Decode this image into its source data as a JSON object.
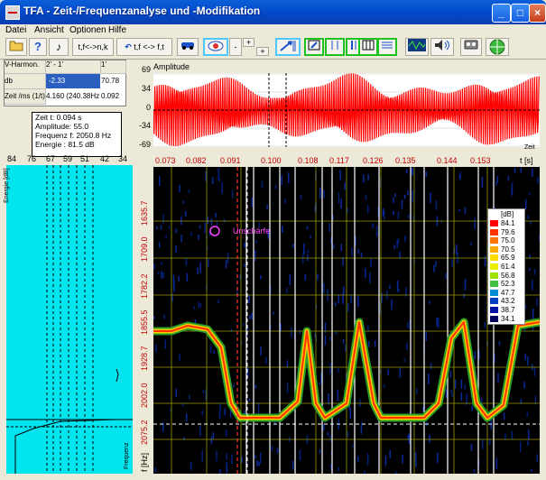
{
  "window": {
    "title": "TFA - Zeit-/Frequenzanalyse und -Modifikation"
  },
  "menu": [
    "Datei",
    "Ansicht",
    "Optionen",
    "Hilfe"
  ],
  "toolbar": {
    "btn_tfnk": "t,f<->n,k",
    "btn_tftf": "t,f <-> f,t",
    "zoom_minus": "-",
    "zoom_plus": "+",
    "zoom_plus2": "+"
  },
  "infogrid": {
    "h1": "V-Harmon.",
    "h2": "2' - 1'",
    "h3": "1'",
    "r1c1": "db",
    "r1c2": "-2.33",
    "r1c3": "70.78",
    "r2c1": "Zeit /ms (1/t)",
    "r2c2": "4.160 (240.38Hz",
    "r2c3": "0.092"
  },
  "infobox": {
    "l1": "Zeit t:  0.094 s",
    "l2": "Amplitude:   55.0",
    "l3": "Frequenz f: 2050.8 Hz",
    "l4": "Energie : 81.5 dB"
  },
  "amplitude": {
    "title": "Amplitude",
    "xlabel": "Zeit",
    "yticks": [
      "69",
      "34",
      "0",
      "-34",
      "-69"
    ]
  },
  "energy": {
    "xticks": [
      "84",
      "76",
      "67",
      "59",
      "51",
      "42",
      "34"
    ],
    "ylabel": "Energie [dB]",
    "freqlabel": "Frequenz"
  },
  "spectrogram": {
    "xticks": [
      "0.073",
      "0.082",
      "0.091",
      "0.100",
      "0.108",
      "0.117",
      "0.126",
      "0.135",
      "0.144",
      "0.153"
    ],
    "xunit": "t [s]",
    "yticks": [
      "1635.7",
      "1709.0",
      "1782.2",
      "1855.5",
      "1928.7",
      "2002.0",
      "2075.2"
    ],
    "yunit": "f [Hz]",
    "annotation": "Unschärfe"
  },
  "legend": {
    "unit": "[dB]",
    "values": [
      "84.1",
      "79.6",
      "75.0",
      "70.5",
      "65.9",
      "61.4",
      "56.8",
      "52.3",
      "47.7",
      "43.2",
      "38.7",
      "34.1"
    ],
    "colors": [
      "#ff0000",
      "#ff3300",
      "#ff7700",
      "#ffaa00",
      "#ffdd00",
      "#e8f000",
      "#a0e000",
      "#40c040",
      "#008cd0",
      "#0040c0",
      "#0010a0",
      "#000060"
    ]
  },
  "colors": {
    "title": "#0a5fd8",
    "cyan": "#00e5ee",
    "red": "#ff0000",
    "label": "#c00000"
  }
}
